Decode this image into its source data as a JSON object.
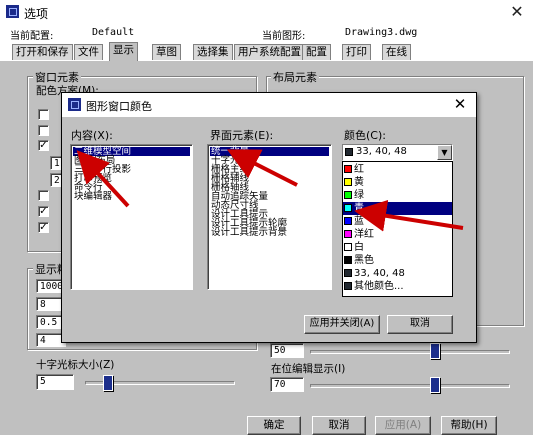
{
  "window": {
    "title": "选项",
    "close_glyph": "✕",
    "current_profile_label": "当前配置:",
    "current_profile_value": "Default",
    "current_drawing_label": "当前图形:",
    "current_drawing_value": "Drawing3.dwg"
  },
  "tabs": [
    {
      "label": "打开和保存",
      "active": false
    },
    {
      "label": "文件",
      "active": false
    },
    {
      "label": "显示",
      "active": true
    },
    {
      "label": "草图",
      "active": false
    },
    {
      "label": "选择集",
      "active": false
    },
    {
      "label": "用户系统配置",
      "active": false
    },
    {
      "label": "配置",
      "active": false
    },
    {
      "label": "打印",
      "active": false
    },
    {
      "label": "在线",
      "active": false
    }
  ],
  "display_tab": {
    "window_elements_title": "窗口元素",
    "color_scheme_label": "配色方案(M):",
    "layout_elements_title": "布局元素",
    "display_precision_title": "显示精",
    "precision_values": [
      "1000",
      "8",
      "0.5",
      "4"
    ],
    "crosshair_label": "十字光标大小(Z)",
    "crosshair_value": "5",
    "crosshair_level": 0.13,
    "fade_value": "50",
    "inplace_edit_label": "在位编辑显示(I)",
    "inplace_edit_value": "70",
    "left_checks": [
      false,
      false,
      true,
      false,
      false,
      true,
      true
    ],
    "left_inputs": [
      "1.",
      "2."
    ]
  },
  "modal": {
    "title": "图形窗口颜色",
    "context_label": "内容(X):",
    "element_label": "界面元素(E):",
    "color_label": "颜色(C):",
    "context_items": [
      "二维模型空间",
      "图纸/布局",
      "三维平行投影",
      "打印预览",
      "命令行",
      "块编辑器"
    ],
    "context_selected": 0,
    "element_items": [
      "统一背景",
      "十字光标",
      "栅格主线",
      "栅格辅线",
      "栅格轴线",
      "自动追踪矢量",
      "动态尺寸线",
      "设计工具提示",
      "设计工具提示轮廓",
      "设计工具提示背景"
    ],
    "element_selected": 0,
    "color_selected": "33, 40, 48",
    "color_options": [
      {
        "label": "红",
        "color": "#ff0000"
      },
      {
        "label": "黄",
        "color": "#ffff00"
      },
      {
        "label": "绿",
        "color": "#00ff00"
      },
      {
        "label": "青",
        "color": "#00ffff"
      },
      {
        "label": "蓝",
        "color": "#0000ff"
      },
      {
        "label": "洋红",
        "color": "#ff00ff"
      },
      {
        "label": "白",
        "color": "#ffffff"
      },
      {
        "label": "黑色",
        "color": "#000000"
      },
      {
        "label": "33, 40, 48",
        "color": "#212830"
      },
      {
        "label": "其他颜色...",
        "color": "#212830"
      }
    ],
    "color_highlight_index": 3,
    "apply_close_label": "应用并关闭(A)",
    "cancel_label": "取消"
  },
  "bottom_buttons": {
    "ok": "确定",
    "cancel": "取消",
    "apply": "应用(A)",
    "help": "帮助(H)"
  },
  "colors": {
    "selection": "#000080",
    "annotation_arrow": "#cc0000",
    "dialog_face": "#c0c0c0"
  }
}
